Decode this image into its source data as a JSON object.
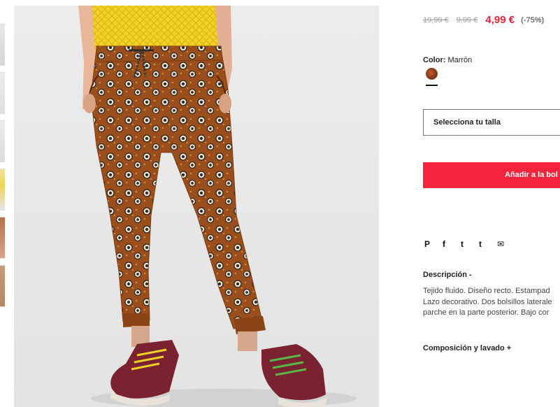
{
  "pricing": {
    "original_price": "19,99 €",
    "previous_price": "9,99 €",
    "current_price": "4,99 €",
    "discount": "(-75%)"
  },
  "color": {
    "label": "Color:",
    "value": "Marrón",
    "swatch_color": "#8a3a17"
  },
  "size": {
    "placeholder": "Selecciona tu talla"
  },
  "cart": {
    "add_label": "Añadir a la bol"
  },
  "social": {
    "icons": [
      {
        "name": "pinterest-icon",
        "glyph": "P"
      },
      {
        "name": "facebook-icon",
        "glyph": "f"
      },
      {
        "name": "twitter-icon",
        "glyph": "t"
      },
      {
        "name": "tumblr-icon",
        "glyph": "t"
      },
      {
        "name": "email-icon",
        "glyph": "✉"
      }
    ]
  },
  "description": {
    "title": "Descripción -",
    "lines": [
      "Tejido fluido. Diseño recto. Estampad",
      "Lazo decorativo. Dos bolsillos laterale",
      "parche en la parte posterior. Bajo cor"
    ]
  },
  "composition": {
    "title": "Composición y lavado +"
  },
  "colors": {
    "sale_red": "#e5213b",
    "button_red": "#f4243c",
    "pants_brown": "#9a4e1c",
    "shirt_yellow": "#f2d028",
    "shoe_burgundy": "#7a2230"
  }
}
